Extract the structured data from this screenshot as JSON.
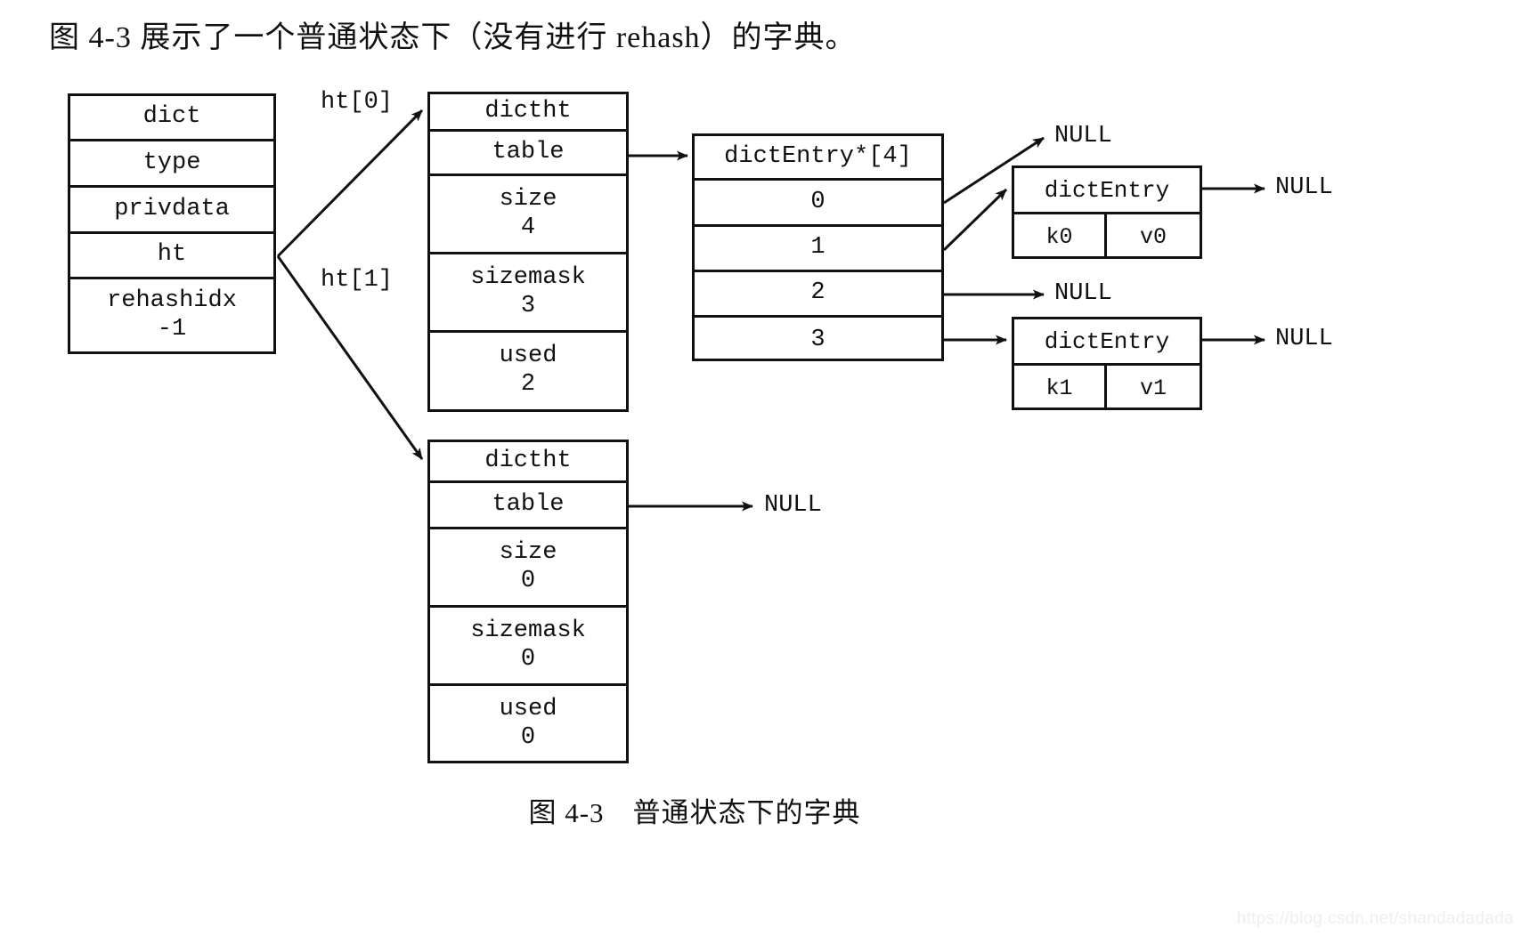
{
  "intro": {
    "text": "图 4-3 展示了一个普通状态下（没有进行 rehash）的字典。"
  },
  "caption": {
    "text": "图 4-3　普通状态下的字典"
  },
  "watermark": {
    "text": "https://blog.csdn.net/shandadadada"
  },
  "dict": {
    "rows": [
      {
        "label": "dict",
        "value": ""
      },
      {
        "label": "type",
        "value": ""
      },
      {
        "label": "privdata",
        "value": ""
      },
      {
        "label": "ht",
        "value": ""
      },
      {
        "label": "rehashidx",
        "value": "-1"
      }
    ]
  },
  "edge_labels": {
    "ht0": "ht[0]",
    "ht1": "ht[1]"
  },
  "dictht0": {
    "rows": [
      {
        "label": "dictht",
        "value": ""
      },
      {
        "label": "table",
        "value": ""
      },
      {
        "label": "size",
        "value": "4"
      },
      {
        "label": "sizemask",
        "value": "3"
      },
      {
        "label": "used",
        "value": "2"
      }
    ]
  },
  "dictht1": {
    "rows": [
      {
        "label": "dictht",
        "value": ""
      },
      {
        "label": "table",
        "value": ""
      },
      {
        "label": "size",
        "value": "0"
      },
      {
        "label": "sizemask",
        "value": "0"
      },
      {
        "label": "used",
        "value": "0"
      }
    ]
  },
  "bucket_table": {
    "header": "dictEntry*[4]",
    "indexes": [
      "0",
      "1",
      "2",
      "3"
    ]
  },
  "entries": [
    {
      "head": "dictEntry",
      "key": "k0",
      "value": "v0"
    },
    {
      "head": "dictEntry",
      "key": "k1",
      "value": "v1"
    }
  ],
  "nulls": {
    "bucket0": "NULL",
    "entry0_next": "NULL",
    "bucket2": "NULL",
    "entry1_next": "NULL",
    "ht1_table": "NULL"
  },
  "colors": {
    "ink": "#111111",
    "paper": "#ffffff",
    "watermark": "#eceff1"
  }
}
